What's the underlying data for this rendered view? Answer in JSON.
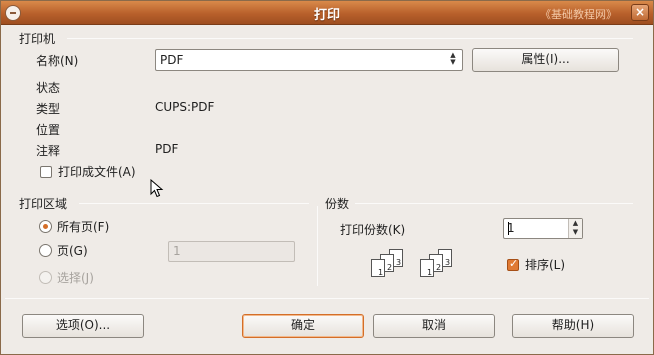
{
  "window": {
    "title": "打印",
    "watermark": "《基础教程网》",
    "close_label": "×"
  },
  "printer": {
    "group_title": "打印机",
    "name_label": "名称(N)",
    "name_value": "PDF",
    "properties_label": "属性(I)...",
    "status_label": "状态",
    "status_value": "",
    "type_label": "类型",
    "type_value": "CUPS:PDF",
    "location_label": "位置",
    "location_value": "",
    "comment_label": "注释",
    "comment_value": "PDF",
    "print_to_file_label": "打印成文件(A)",
    "print_to_file_checked": false
  },
  "range": {
    "group_title": "打印区域",
    "all_pages_label": "所有页(F)",
    "pages_label": "页(G)",
    "pages_value": "1",
    "selection_label": "选择(J)",
    "selected": "all"
  },
  "copies": {
    "group_title": "份数",
    "count_label": "打印份数(K)",
    "count_value": "1",
    "collate_label": "排序(L)",
    "collate_checked": true,
    "collate_pages": [
      "1",
      "2",
      "3"
    ]
  },
  "buttons": {
    "options": "选项(O)...",
    "ok": "确定",
    "cancel": "取消",
    "help": "帮助(H)"
  },
  "colors": {
    "accent": "#d46e28",
    "titlebar": "#b8602b"
  }
}
